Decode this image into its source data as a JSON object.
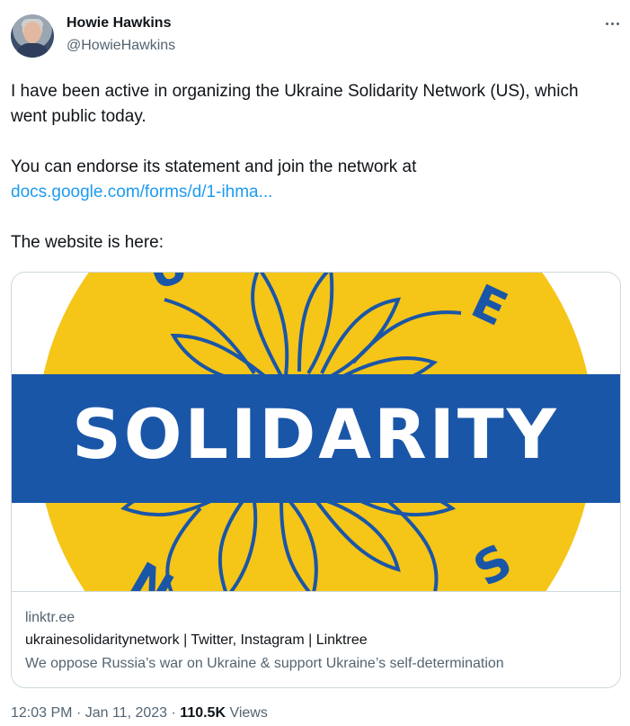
{
  "author": {
    "display_name": "Howie Hawkins",
    "handle": "@HowieHawkins"
  },
  "tweet": {
    "line1": "I have been active in organizing the Ukraine Solidarity Network (US), which went public today.",
    "line2": "You can endorse its statement and join the network at",
    "link": "docs.google.com/forms/d/1-ihma...",
    "line3": "The website is here:"
  },
  "card": {
    "image_banner_text": "SOLIDARITY",
    "domain": "linktr.ee",
    "title": "ukrainesolidaritynetwork | Twitter, Instagram | Linktree",
    "description": "We oppose Russia’s war on Ukraine & support Ukraine’s self-determination"
  },
  "footer": {
    "time": "12:03 PM",
    "separator": "·",
    "date": "Jan 11, 2023",
    "views_count": "110.5K",
    "views_label": "Views"
  },
  "colors": {
    "link": "#1d9bf0",
    "ukraine_yellow": "#f5c518",
    "ukraine_blue": "#1a56a8"
  },
  "icons": {
    "more": "more-horizontal-icon",
    "avatar": "profile-photo"
  }
}
